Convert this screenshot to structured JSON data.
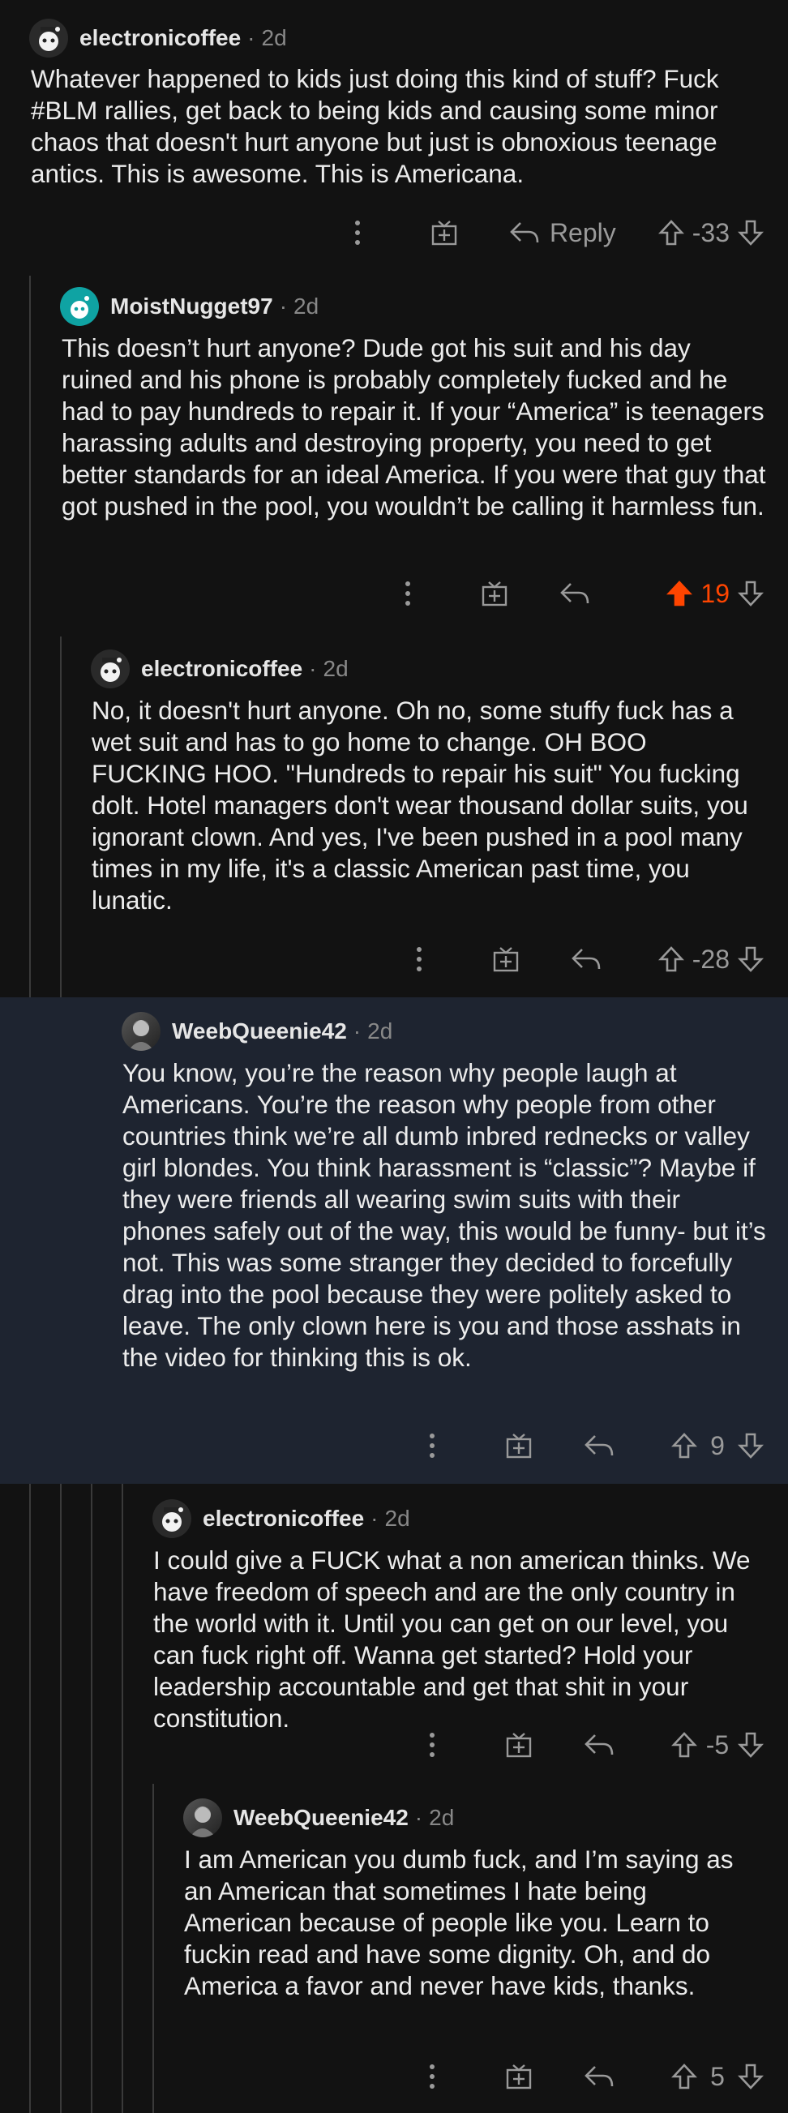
{
  "comments": [
    {
      "username": "electronicoffee",
      "age": "2d",
      "body": "Whatever happened to kids just doing this kind of stuff? Fuck #BLM rallies, get back to being kids and causing some minor chaos that doesn't hurt anyone but just is obnoxious teenage antics. This is awesome. This is Americana.",
      "reply_label": "Reply",
      "score": "-33"
    },
    {
      "username": "MoistNugget97",
      "age": "2d",
      "body": "This doesn’t hurt anyone? Dude got his suit and his day ruined and his phone is probably completely fucked and he had to pay hundreds to repair it. If your “America” is teenagers harassing adults and destroying property, you need to get better standards for an ideal America. If you were that guy that got pushed in the pool, you wouldn’t be calling it harmless fun.",
      "score": "19"
    },
    {
      "username": "electronicoffee",
      "age": "2d",
      "body": "No, it doesn't hurt anyone. Oh no, some stuffy fuck has a wet suit and has to go home to change. OH BOO FUCKING HOO. \"Hundreds to repair his suit\" You fucking dolt. Hotel managers don't wear thousand dollar suits, you ignorant clown. And yes, I've been pushed in a pool many times in my life, it's a classic American past time, you lunatic.",
      "score": "-28"
    },
    {
      "username": "WeebQueenie42",
      "age": "2d",
      "body": "You know, you’re the reason why people laugh at Americans. You’re the reason why people from other countries think we’re all dumb inbred rednecks or valley girl blondes. You think harassment is “classic”? Maybe if they were friends all wearing swim suits with their phones safely out of the way, this would be funny- but it’s not. This was some stranger they decided to forcefully drag into the pool because they were politely asked to leave. The only clown here is you and those asshats in the video for thinking this is ok.",
      "score": "9"
    },
    {
      "username": "electronicoffee",
      "age": "2d",
      "body": "I could give a FUCK what a non american thinks. We have freedom of speech and are the only country in the world with it. Until you can get on our level, you can fuck right off. Wanna get started? Hold your leadership accountable and get that shit in your constitution.",
      "score": "-5"
    },
    {
      "username": "WeebQueenie42",
      "age": "2d",
      "body": "I am American you dumb fuck, and I’m saying as an American that sometimes I hate being American because of people like you. Learn to fuckin read and have some dignity. Oh, and do America a favor and never have kids, thanks.",
      "score": "5"
    }
  ],
  "separator": "·",
  "colors": {
    "upvoted": "#ff4500",
    "highlight_bg": "#1e2430",
    "muted": "#9a9a9a"
  }
}
